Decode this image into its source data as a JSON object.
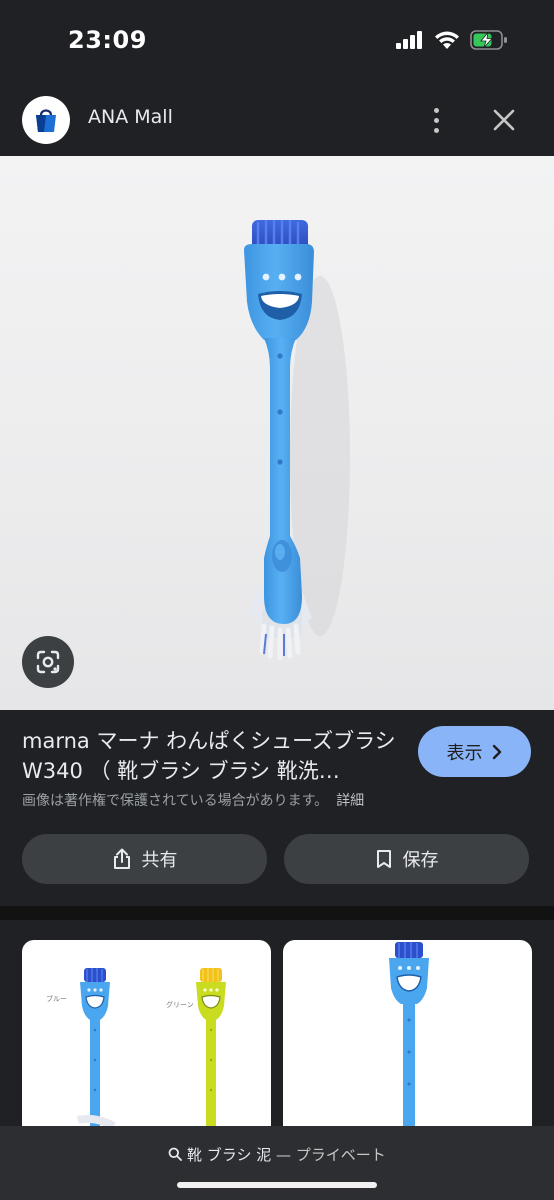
{
  "status_bar": {
    "time": "23:09",
    "icons": [
      "signal-icon",
      "wifi-icon",
      "battery-charging-icon"
    ]
  },
  "source": {
    "name": "ANA Mall",
    "logo_icon": "shopping-bag-icon",
    "menu_icon": "more-vert-icon",
    "close_icon": "close-icon"
  },
  "product": {
    "title": "marna マーナ わんぱくシューズブラシ W340 （ 靴ブラシ ブラシ 靴洗…",
    "visit_label": "表示",
    "copyright_notice": "画像は著作権で保護されている場合があります。",
    "details_link": "詳細",
    "share_label": "共有",
    "save_label": "保存"
  },
  "related": {
    "card1_labels": [
      "ブルー",
      "グリーン"
    ]
  },
  "bottom_bar": {
    "query": "靴 ブラシ 泥",
    "mode": "— プライベート"
  },
  "colors": {
    "background": "#202124",
    "accent": "#8ab4f8",
    "brush_handle": "#4aa6ef",
    "brush_bristles": "#2c4fcc",
    "brush_green": "#c9dc20"
  }
}
